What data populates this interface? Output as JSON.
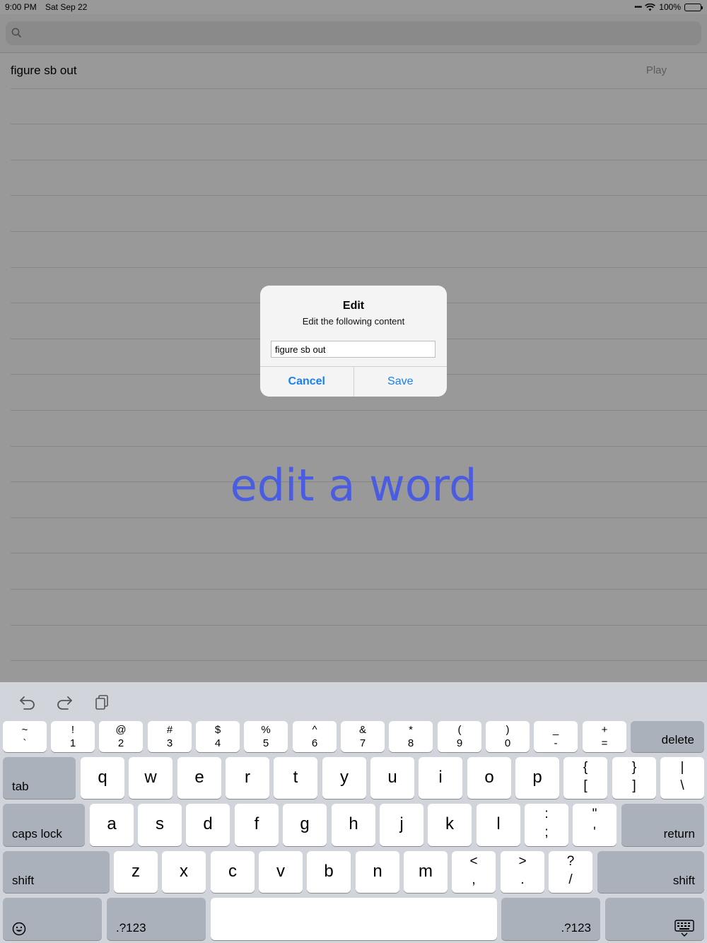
{
  "status_bar": {
    "time": "9:00 PM",
    "date": "Sat Sep 22",
    "battery": "100%"
  },
  "search": {
    "placeholder": "",
    "value": ""
  },
  "list": {
    "items": [
      {
        "word": "figure sb out",
        "action": "Play"
      }
    ]
  },
  "caption": "edit a word",
  "alert": {
    "title": "Edit",
    "message": "Edit the following content",
    "field_value": "figure sb out",
    "cancel_label": "Cancel",
    "save_label": "Save"
  },
  "keyboard": {
    "number_row": [
      {
        "top": "~",
        "bottom": "`"
      },
      {
        "top": "!",
        "bottom": "1"
      },
      {
        "top": "@",
        "bottom": "2"
      },
      {
        "top": "#",
        "bottom": "3"
      },
      {
        "top": "$",
        "bottom": "4"
      },
      {
        "top": "%",
        "bottom": "5"
      },
      {
        "top": "^",
        "bottom": "6"
      },
      {
        "top": "&",
        "bottom": "7"
      },
      {
        "top": "*",
        "bottom": "8"
      },
      {
        "top": "(",
        "bottom": "9"
      },
      {
        "top": ")",
        "bottom": "0"
      },
      {
        "top": "_",
        "bottom": "-"
      },
      {
        "top": "+",
        "bottom": "="
      }
    ],
    "delete_label": "delete",
    "tab_label": "tab",
    "qwerty_row": [
      "q",
      "w",
      "e",
      "r",
      "t",
      "y",
      "u",
      "i",
      "o",
      "p"
    ],
    "qwerty_symbols": [
      {
        "top": "{",
        "bottom": "["
      },
      {
        "top": "}",
        "bottom": "]"
      },
      {
        "top": "|",
        "bottom": "\\"
      }
    ],
    "caps_label": "caps lock",
    "home_row": [
      "a",
      "s",
      "d",
      "f",
      "g",
      "h",
      "j",
      "k",
      "l"
    ],
    "home_symbols": [
      {
        "top": ":",
        "bottom": ";"
      },
      {
        "top": "\"",
        "bottom": "'"
      }
    ],
    "return_label": "return",
    "shift_label": "shift",
    "bottom_row": [
      "z",
      "x",
      "c",
      "v",
      "b",
      "n",
      "m"
    ],
    "bottom_symbols": [
      {
        "top": "<",
        "bottom": ","
      },
      {
        "top": ">",
        "bottom": "."
      },
      {
        "top": "?",
        "bottom": "/"
      }
    ],
    "numbers_label": ".?123",
    "icons": {
      "undo": "undo-icon",
      "redo": "redo-icon",
      "paste": "paste-icon",
      "emoji": "emoji-icon",
      "dismiss": "keyboard-dismiss-icon"
    }
  }
}
